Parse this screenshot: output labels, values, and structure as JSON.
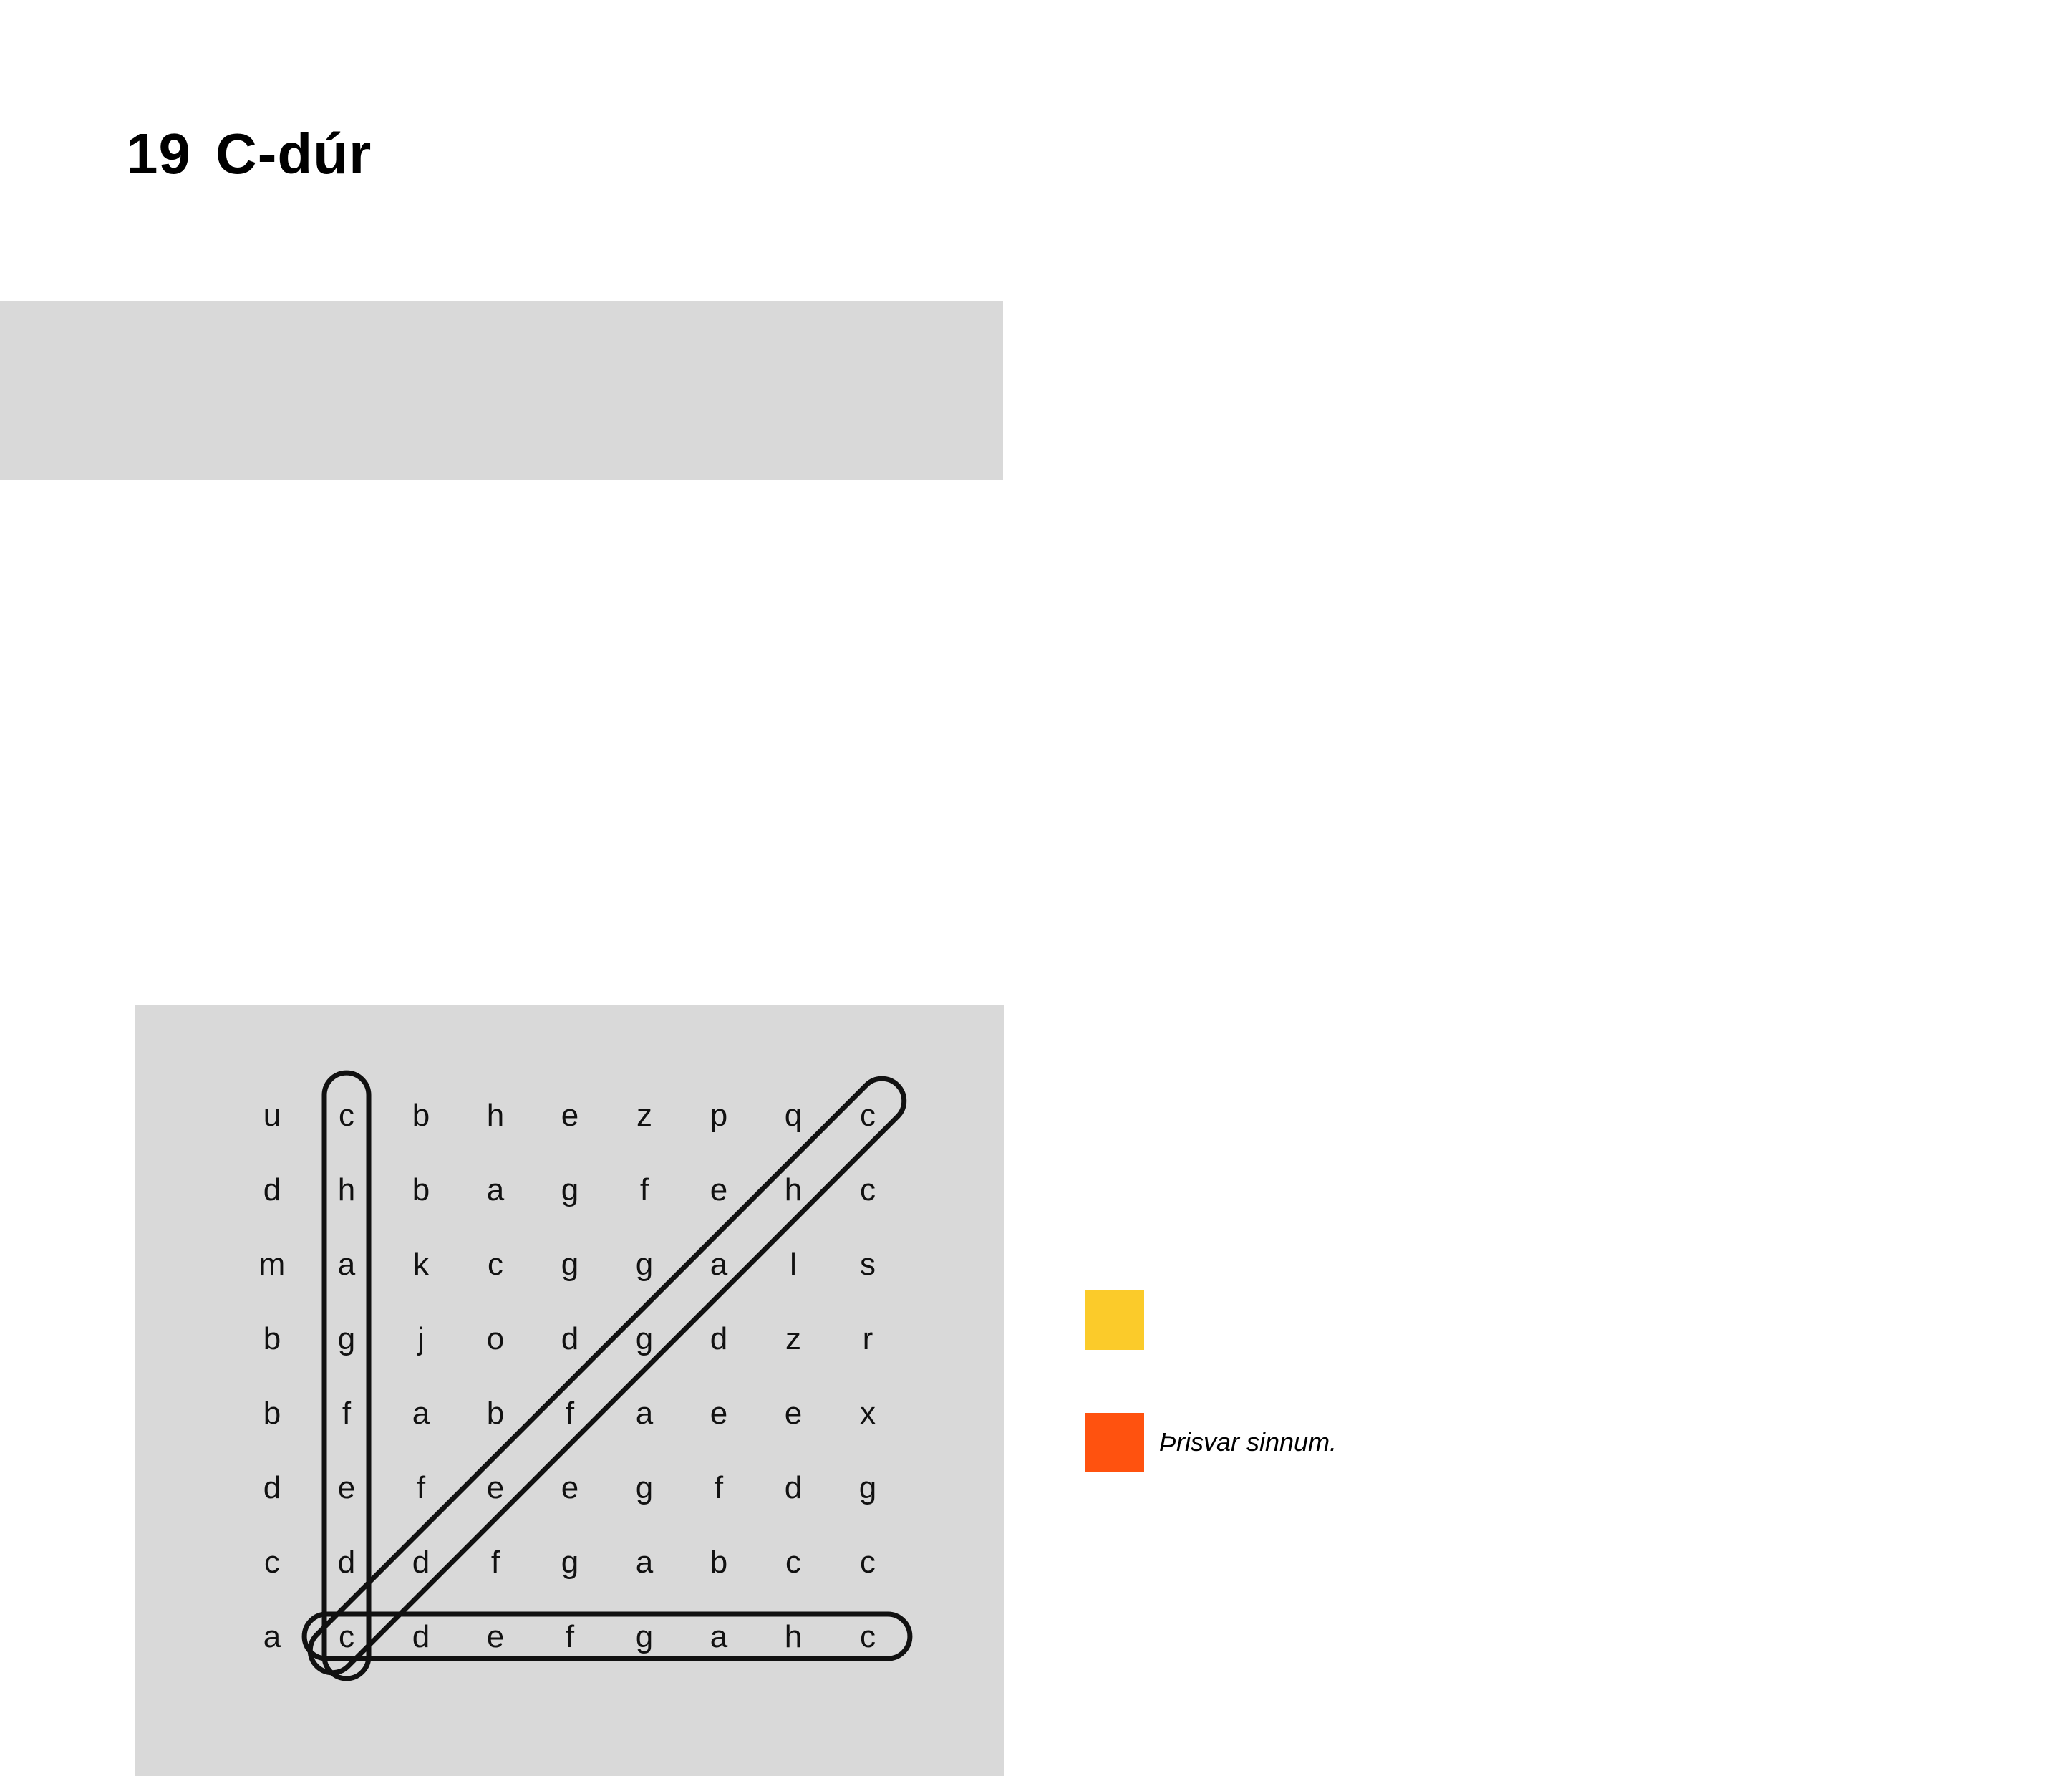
{
  "header": {
    "number": "19",
    "title": "C-dúr"
  },
  "puzzle": {
    "rows": [
      [
        "u",
        "c",
        "b",
        "h",
        "e",
        "z",
        "p",
        "q",
        "c"
      ],
      [
        "d",
        "h",
        "b",
        "a",
        "g",
        "f",
        "e",
        "h",
        "c"
      ],
      [
        "m",
        "a",
        "k",
        "c",
        "g",
        "g",
        "a",
        "l",
        "s"
      ],
      [
        "b",
        "g",
        "j",
        "o",
        "d",
        "g",
        "d",
        "z",
        "r"
      ],
      [
        "b",
        "f",
        "a",
        "b",
        "f",
        "a",
        "e",
        "e",
        "x"
      ],
      [
        "d",
        "e",
        "f",
        "e",
        "e",
        "g",
        "f",
        "d",
        "g"
      ],
      [
        "c",
        "d",
        "d",
        "f",
        "g",
        "a",
        "b",
        "c",
        "c"
      ],
      [
        "a",
        "c",
        "d",
        "e",
        "f",
        "g",
        "a",
        "h",
        "c"
      ]
    ],
    "found_words": [
      {
        "direction": "down",
        "from": [
          0,
          1
        ],
        "to": [
          7,
          1
        ]
      },
      {
        "direction": "diagonal-up",
        "from": [
          7,
          1
        ],
        "to": [
          0,
          8
        ]
      },
      {
        "direction": "across",
        "from": [
          7,
          1
        ],
        "to": [
          7,
          8
        ]
      }
    ]
  },
  "legend": {
    "colors": {
      "yellow": "#fbcb2a",
      "orange": "#ff520f"
    },
    "items": [
      {
        "color": "#fbcb2a",
        "label": ""
      },
      {
        "color": "#ff520f",
        "label": "Þrisvar sinnum."
      }
    ]
  }
}
